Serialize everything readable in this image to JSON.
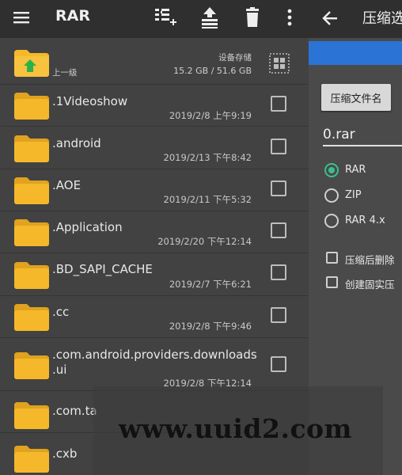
{
  "toolbar": {
    "title": "RAR",
    "icons": [
      "menu-icon",
      "add-to-archive-icon",
      "extract-icon",
      "delete-icon",
      "more-vert-icon"
    ]
  },
  "location": {
    "up_label": "上一级",
    "storage_label": "设备存储",
    "storage_size": "15.2 GB / 51.6 GB"
  },
  "files": [
    {
      "name": ".1Videoshow",
      "date": "2019/2/8 上午9:19"
    },
    {
      "name": ".android",
      "date": "2019/2/13 下午8:42"
    },
    {
      "name": ".AOE",
      "date": "2019/2/11 下午5:32"
    },
    {
      "name": ".Application",
      "date": "2019/2/20 下午12:14"
    },
    {
      "name": ".BD_SAPI_CACHE",
      "date": "2019/2/7 下午6:21"
    },
    {
      "name": ".cc",
      "date": "2019/2/8 下午9:46"
    },
    {
      "name": ".com.android.providers.downloads",
      "name2": ".ui",
      "date": "2019/2/8 下午12:14"
    },
    {
      "name": ".com.ta",
      "date": ""
    },
    {
      "name": ".cxb",
      "date": ""
    }
  ],
  "dialog": {
    "title": "压缩选",
    "archive_name_button": "压缩文件名",
    "archive_name": "0.rar",
    "formats": [
      "RAR",
      "ZIP",
      "RAR 4.x"
    ],
    "selected_format": "RAR",
    "options": [
      "压缩后删除",
      "创建固实压"
    ]
  },
  "watermark": "www.uuid2.com",
  "colors": {
    "accent_blue": "#2b74d6",
    "radio_selected": "#3bbf8f",
    "folder": "#f4b82a"
  }
}
